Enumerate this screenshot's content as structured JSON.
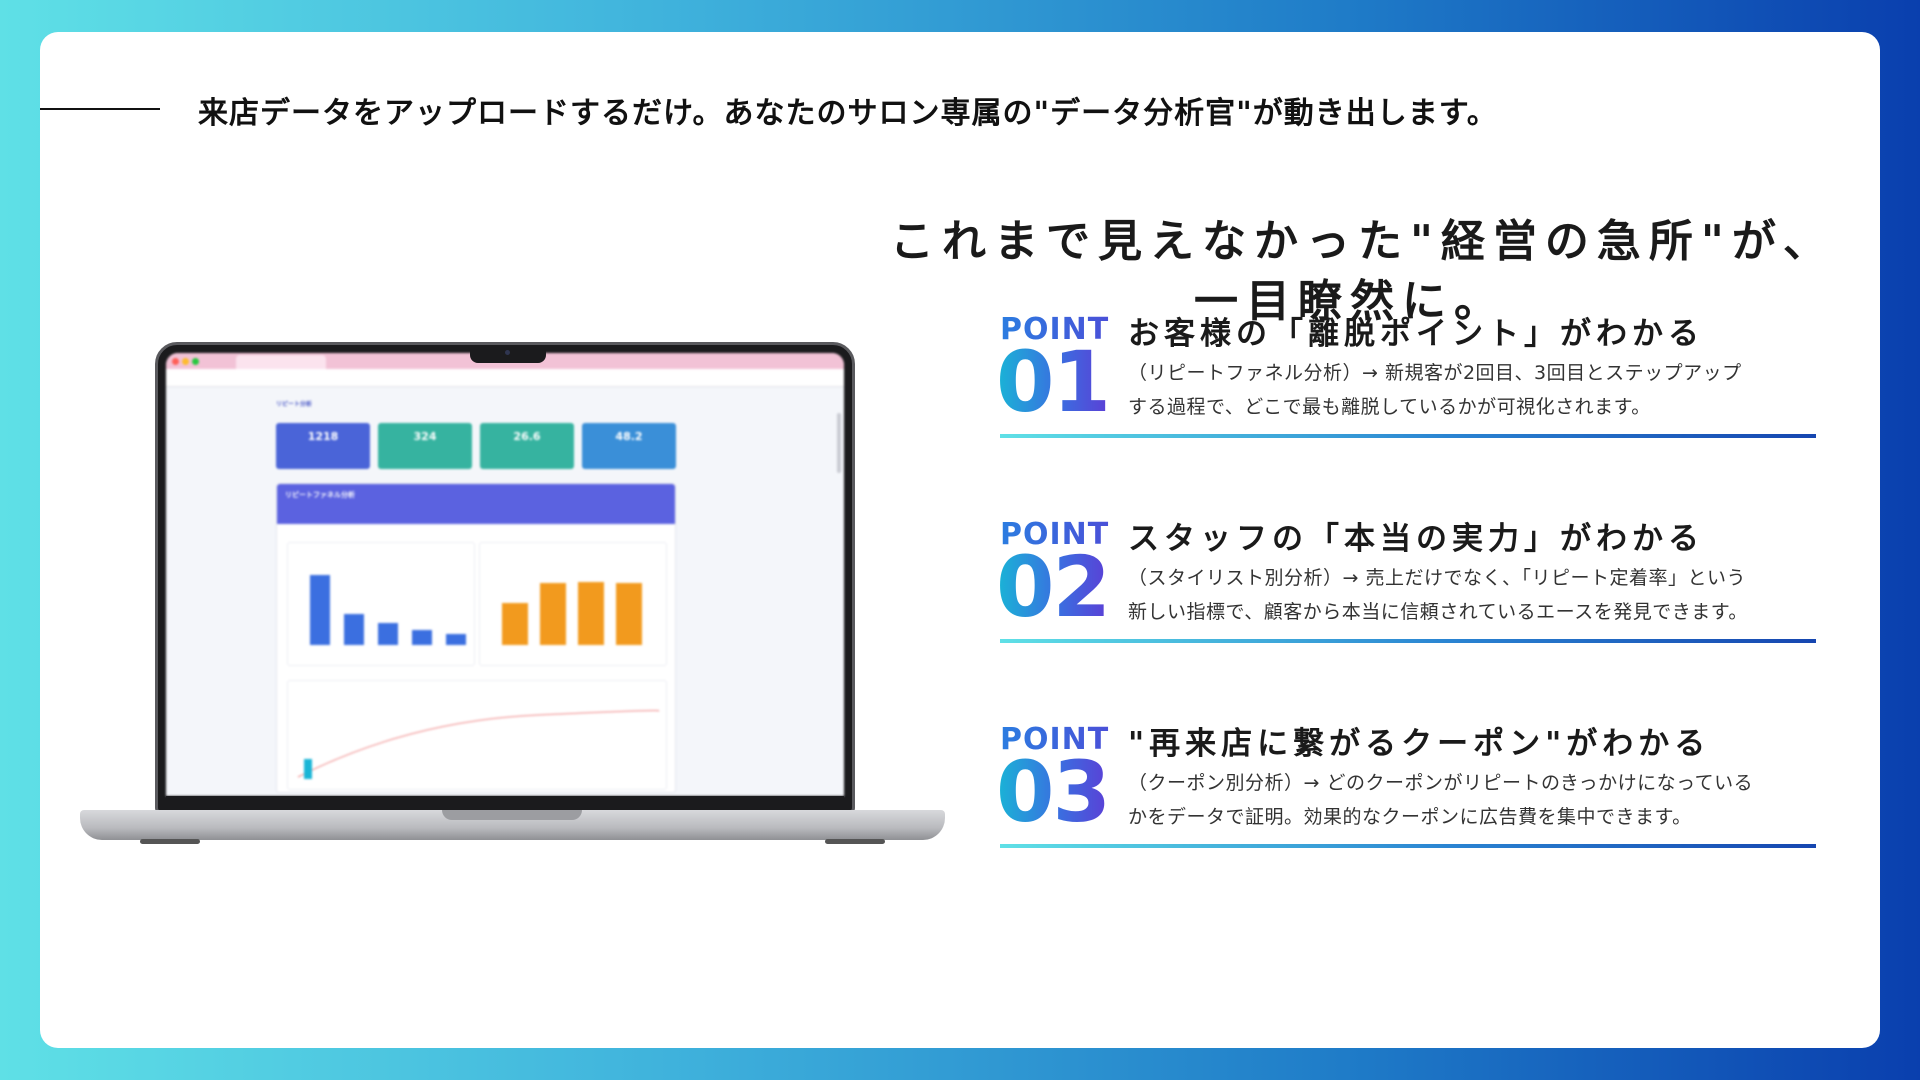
{
  "caption": "来店データをアップロードするだけ。あなたのサロン専属の\"データ分析官\"が動き出します。",
  "headline": {
    "line1": "これまで見えなかった\"経営の急所\"が、",
    "line2": "一目瞭然に。"
  },
  "points": [
    {
      "label": "POINT",
      "number": "01",
      "title": "お客様の「離脱ポイント」がわかる",
      "desc_line1": "（リピートファネル分析）→ 新規客が2回目、3回目とステップアップ",
      "desc_line2": "する過程で、どこで最も離脱しているかが可視化されます。"
    },
    {
      "label": "POINT",
      "number": "02",
      "title": "スタッフの「本当の実力」がわかる",
      "desc_line1": "（スタイリスト別分析）→ 売上だけでなく、「リピート定着率」という",
      "desc_line2": "新しい指標で、顧客から本当に信頼されているエースを発見できます。"
    },
    {
      "label": "POINT",
      "number": "03",
      "title": "\"再来店に繋がるクーポン\"がわかる",
      "desc_line1": "（クーポン別分析）→ どのクーポンがリピートのきっかけになっている",
      "desc_line2": "かをデータで証明。効果的なクーポンに広告費を集中できます。"
    }
  ],
  "laptop_screen": {
    "page_title": "リピート分析",
    "kpis": [
      {
        "value": "1218",
        "color": "#4a64d8"
      },
      {
        "value": "324",
        "color": "#36b3a0"
      },
      {
        "value": "26.6",
        "color": "#36b3a0"
      },
      {
        "value": "48.2",
        "color": "#3a8fd8"
      }
    ],
    "section_title": "リピートファネル分析",
    "funnel_chart": {
      "values": [
        100,
        45,
        32,
        22,
        16
      ],
      "color": "#3b6fe0"
    },
    "retention_chart": {
      "values": [
        60,
        88,
        90,
        88
      ],
      "color": "#f29a1e"
    }
  }
}
